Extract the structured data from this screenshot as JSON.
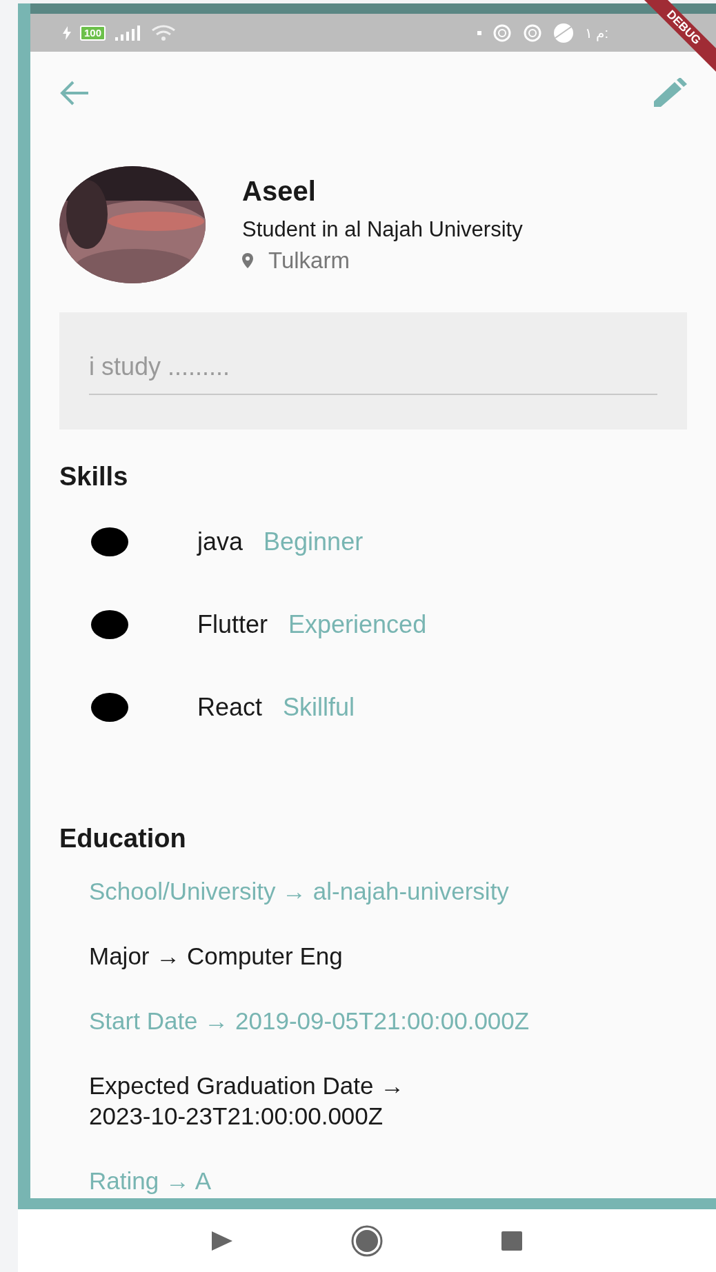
{
  "status_bar": {
    "battery": "100",
    "time": "م ١:"
  },
  "debug_banner": "DEBUG",
  "profile": {
    "name": "Aseel",
    "headline": "Student in al Najah University",
    "location": "Tulkarm"
  },
  "about_field": {
    "placeholder": "i study ........."
  },
  "skills": {
    "title": "Skills",
    "items": [
      {
        "name": "java",
        "level_label": "Beginner"
      },
      {
        "name": "Flutter",
        "level_label": "Experienced"
      },
      {
        "name": "React",
        "level_label": "Skillful"
      }
    ]
  },
  "education": {
    "title": "Education",
    "items": [
      {
        "label": "School/University →",
        "value": "al-najah-university",
        "color": "#78b5b2"
      },
      {
        "label": "Major →",
        "value": "Computer Eng",
        "color": "#1a1a1a"
      },
      {
        "label": "Start Date →",
        "value": "2019-09-05T21:00:00.000Z",
        "color": "#78b5b2"
      },
      {
        "label": "Expected Graduation Date →",
        "value": "2023-10-23T21:00:00.000Z",
        "color": "#1a1a1a"
      },
      {
        "label": "Rating →",
        "value": "A",
        "color": "#78b5b2"
      }
    ]
  }
}
